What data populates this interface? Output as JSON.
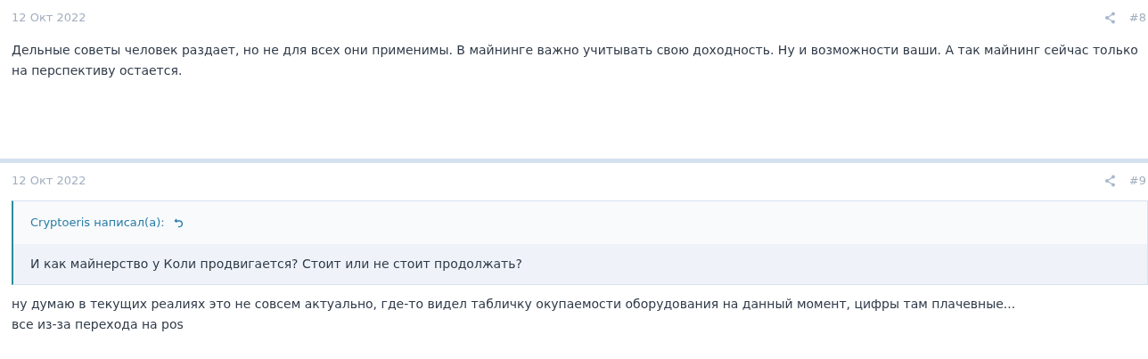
{
  "posts": [
    {
      "date": "12 Окт 2022",
      "number": "#8",
      "body": [
        "Дельные советы человек раздает, но не для всех они применимы. В майнинге важно учитывать свою доходность. Ну и возможности ваши. А так майнинг сейчас только на перспективу остается."
      ]
    },
    {
      "date": "12 Окт 2022",
      "number": "#9",
      "quote": {
        "author": "Cryptoeris написал(а):",
        "text": "И как майнерство у Коли продвигается? Стоит или не стоит продолжать?"
      },
      "body": [
        "ну думаю в текущих реалиях это не совсем актуально, где-то видел табличку окупаемости оборудования на данный момент, цифры там плачевные...",
        "все из-за перехода на pos"
      ]
    }
  ]
}
